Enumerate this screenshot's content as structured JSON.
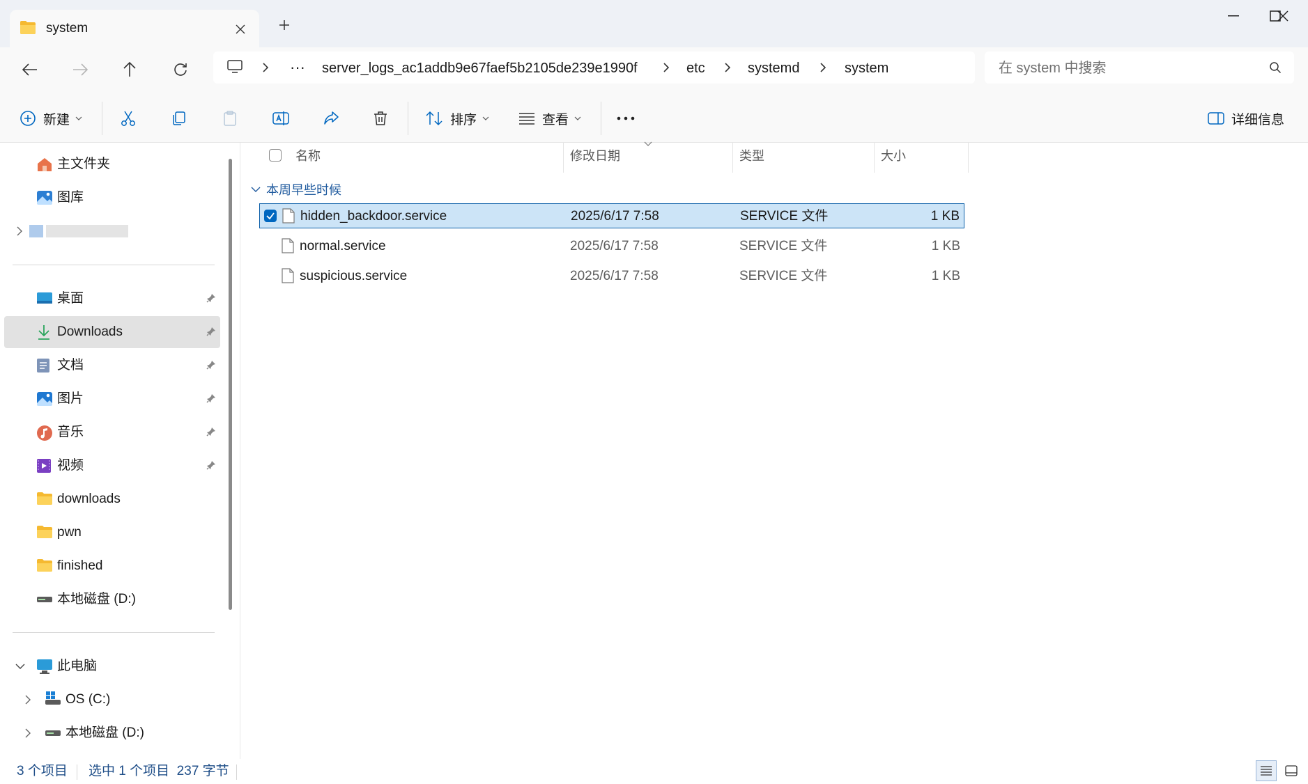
{
  "window": {
    "tab_title": "system",
    "buttons": [
      "minimize",
      "maximize",
      "close"
    ]
  },
  "breadcrumb": [
    "server_logs_ac1addb9e67faef5b2105de239e1990f",
    "etc",
    "systemd",
    "system"
  ],
  "search": {
    "placeholder": "在 system 中搜索"
  },
  "toolbar": {
    "new_label": "新建",
    "sort_label": "排序",
    "view_label": "查看",
    "details_label": "详细信息"
  },
  "sidebar": {
    "top": [
      {
        "label": "主文件夹",
        "icon": "home-icon"
      },
      {
        "label": "图库",
        "icon": "gallery-icon"
      }
    ],
    "quick_access": [
      {
        "label": "桌面",
        "icon": "desktop-icon",
        "pinned": true
      },
      {
        "label": "Downloads",
        "icon": "download-icon",
        "pinned": true,
        "active": true
      },
      {
        "label": "文档",
        "icon": "document-icon",
        "pinned": true
      },
      {
        "label": "图片",
        "icon": "pictures-icon",
        "pinned": true
      },
      {
        "label": "音乐",
        "icon": "music-icon",
        "pinned": true
      },
      {
        "label": "视频",
        "icon": "video-icon",
        "pinned": true
      },
      {
        "label": "downloads",
        "icon": "folder-icon",
        "pinned": false
      },
      {
        "label": "pwn",
        "icon": "folder-icon",
        "pinned": false
      },
      {
        "label": "finished",
        "icon": "folder-icon",
        "pinned": false
      },
      {
        "label": "本地磁盘 (D:)",
        "icon": "drive-icon",
        "pinned": false
      }
    ],
    "this_pc": {
      "label": "此电脑",
      "icon": "pc-icon"
    },
    "drives": [
      {
        "label": "OS (C:)",
        "icon": "windows-drive-icon"
      },
      {
        "label": "本地磁盘 (D:)",
        "icon": "drive-icon"
      }
    ]
  },
  "columns": {
    "name": "名称",
    "modified": "修改日期",
    "type": "类型",
    "size": "大小"
  },
  "group_header": "本周早些时候",
  "files": [
    {
      "name": "hidden_backdoor.service",
      "modified": "2025/6/17 7:58",
      "type": "SERVICE 文件",
      "size": "1 KB",
      "selected": true
    },
    {
      "name": "normal.service",
      "modified": "2025/6/17 7:58",
      "type": "SERVICE 文件",
      "size": "1 KB",
      "selected": false
    },
    {
      "name": "suspicious.service",
      "modified": "2025/6/17 7:58",
      "type": "SERVICE 文件",
      "size": "1 KB",
      "selected": false
    }
  ],
  "status": {
    "item_count": "3 个项目",
    "selection": "选中 1 个项目  237 字节"
  },
  "colors": {
    "accent": "#0067c0",
    "selection_bg": "#cce4f7",
    "title_bar": "#eef1f6",
    "folder": "#f8c93e"
  }
}
